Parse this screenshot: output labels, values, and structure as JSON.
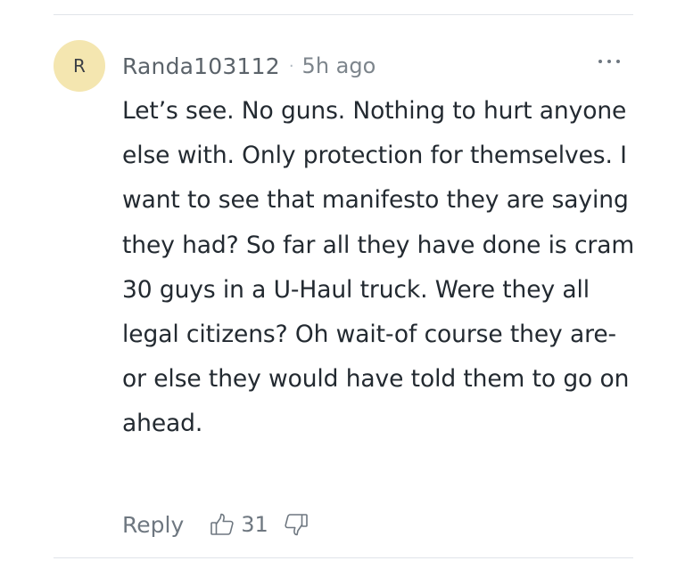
{
  "comment": {
    "avatar_initial": "R",
    "username": "Randa103112",
    "separator": "·",
    "time_ago": "5h ago",
    "text": "Let’s see. No guns. Nothing to hurt anyone else with. Only protection for themselves. I want to see that manifesto they are saying they had? So far all they have done is cram 30 guys in a U-Haul truck. Were they all legal citizens? Oh wait-of course they are-or else they would have told them to go on ahead.",
    "reply_label": "Reply",
    "upvote_count": "31",
    "icons": {
      "more": "more-options-icon",
      "upvote": "thumbs-up-icon",
      "downvote": "thumbs-down-icon"
    },
    "colors": {
      "avatar_bg": "#f4e6b0",
      "text": "#232a31",
      "muted": "#6e7780",
      "divider": "#e0e4e9"
    }
  }
}
